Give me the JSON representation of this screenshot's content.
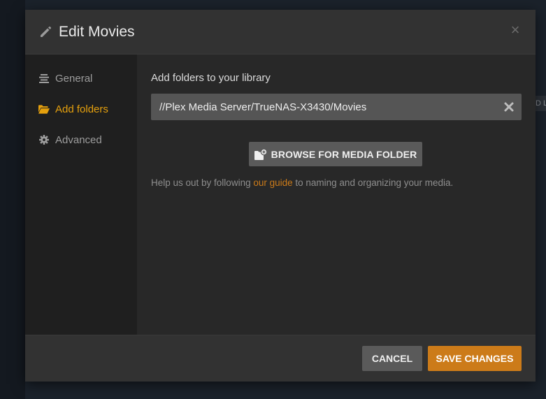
{
  "background": {
    "right_tab_text": "D L"
  },
  "modal": {
    "title": "Edit Movies",
    "close_glyph": "×"
  },
  "sidebar": {
    "items": [
      {
        "label": "General",
        "icon": "general-icon",
        "active": false
      },
      {
        "label": "Add folders",
        "icon": "folder-icon",
        "active": true
      },
      {
        "label": "Advanced",
        "icon": "gear-icon",
        "active": false
      }
    ]
  },
  "content": {
    "section_label": "Add folders to your library",
    "folder_path": "//Plex Media Server/TrueNAS-X3430/Movies",
    "browse_label": "BROWSE FOR MEDIA FOLDER",
    "help_prefix": "Help us out by following ",
    "help_link": "our guide",
    "help_suffix": " to naming and organizing your media."
  },
  "footer": {
    "cancel_label": "CANCEL",
    "save_label": "SAVE CHANGES"
  },
  "colors": {
    "accent": "#e5a00d",
    "save_button": "#cc7b19",
    "page_background": "#1b222b",
    "modal_background": "#282828"
  }
}
